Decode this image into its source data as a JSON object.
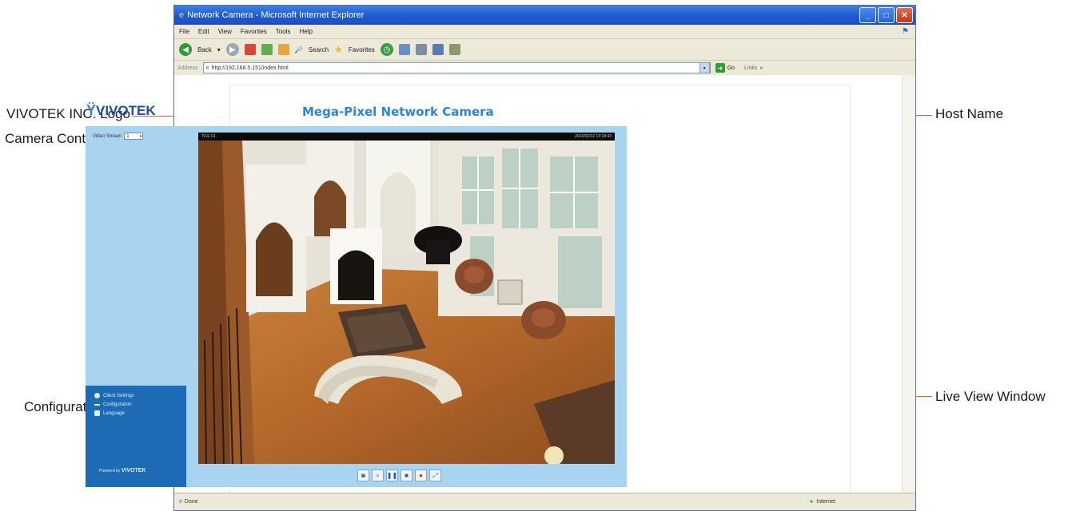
{
  "callouts": {
    "logo": "VIVOTEK INC. Logo",
    "camera_control": "Camera Control Area",
    "configuration": "Configuration Area",
    "host_name": "Host Name",
    "live_view": "Live View Window"
  },
  "browser": {
    "title": "Network Camera - Microsoft Internet Explorer",
    "menu": [
      "File",
      "Edit",
      "View",
      "Favorites",
      "Tools",
      "Help"
    ],
    "toolbar": {
      "back": "Back",
      "search": "Search",
      "favorites": "Favorites"
    },
    "address_label": "Address",
    "address_value": "http://192.168.5.151/index.html",
    "go": "Go",
    "links": "Links",
    "status_left": "Done",
    "status_right": "Internet"
  },
  "page": {
    "logo": "VIVOTEK",
    "host_name": "Mega-Pixel Network Camera",
    "video_stream_label": "Video Stream",
    "video_stream_value": "1",
    "video_overlay_left": "TILE 01",
    "video_overlay_right": "2010/02/22 13:18:43",
    "config_items": [
      "Client Settings",
      "Configuration",
      "Language"
    ],
    "powered_by_prefix": "Powered by",
    "powered_by_brand": "VIVOTEK"
  },
  "colors": {
    "callout_line": "#e0631c",
    "host_name": "#2e83d4",
    "sidebar_light": "#a8d4f2",
    "sidebar_dark": "#1d6bb5"
  },
  "icons": {
    "controls": [
      "snapshot-icon",
      "digital-zoom-icon",
      "pause-icon",
      "stop-icon",
      "record-icon",
      "fullscreen-icon"
    ]
  }
}
